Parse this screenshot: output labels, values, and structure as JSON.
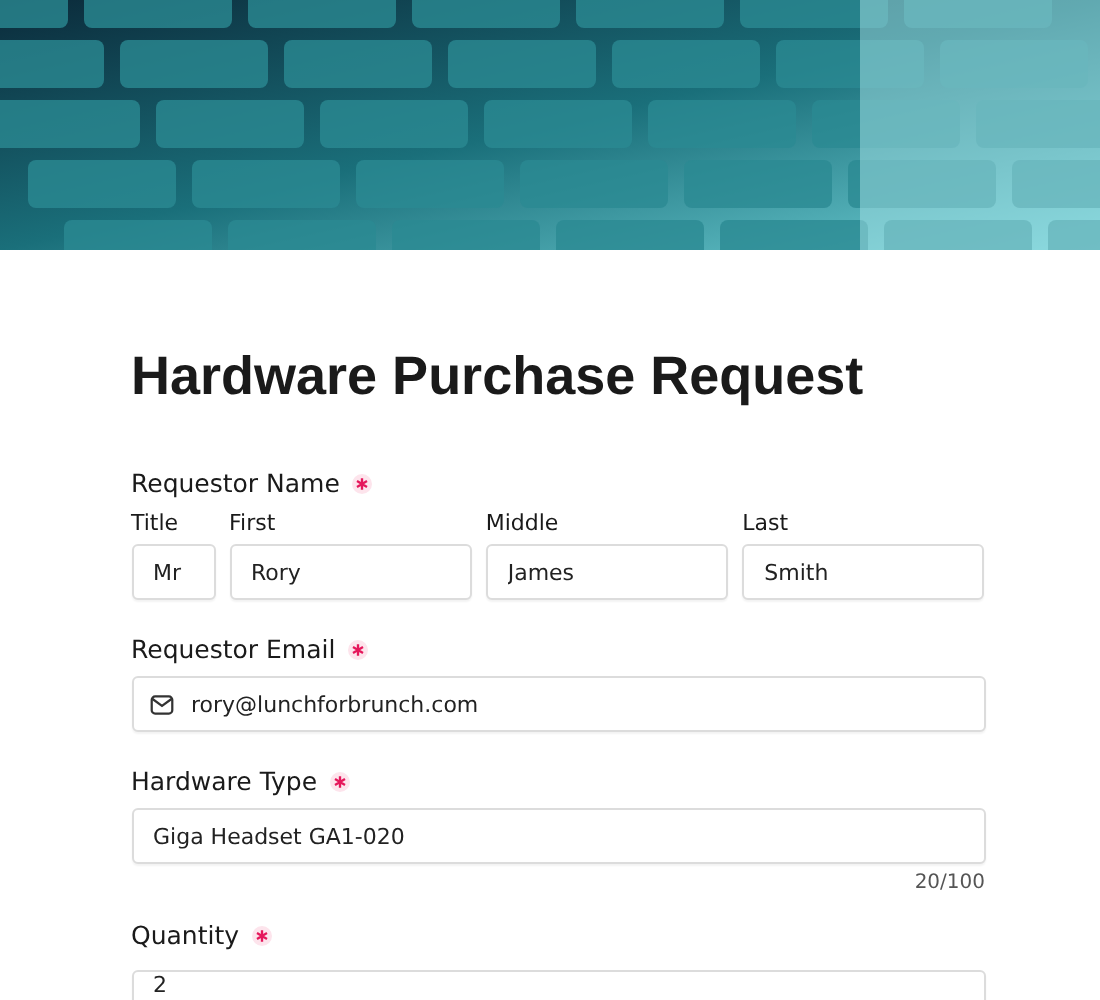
{
  "title": "Hardware Purchase Request",
  "name_field": {
    "label": "Requestor Name",
    "required": true,
    "parts": [
      {
        "label": "Title",
        "value": "Mr"
      },
      {
        "label": "First",
        "value": "Rory"
      },
      {
        "label": "Middle",
        "value": "James"
      },
      {
        "label": "Last",
        "value": "Smith"
      }
    ]
  },
  "email_field": {
    "label": "Requestor Email",
    "required": true,
    "value": "rory@lunchforbrunch.com"
  },
  "hardware_field": {
    "label": "Hardware Type",
    "required": true,
    "value": "Giga Headset GA1-020",
    "counter": "20/100"
  },
  "quantity_field": {
    "label": "Quantity",
    "required": true,
    "value": "2"
  }
}
